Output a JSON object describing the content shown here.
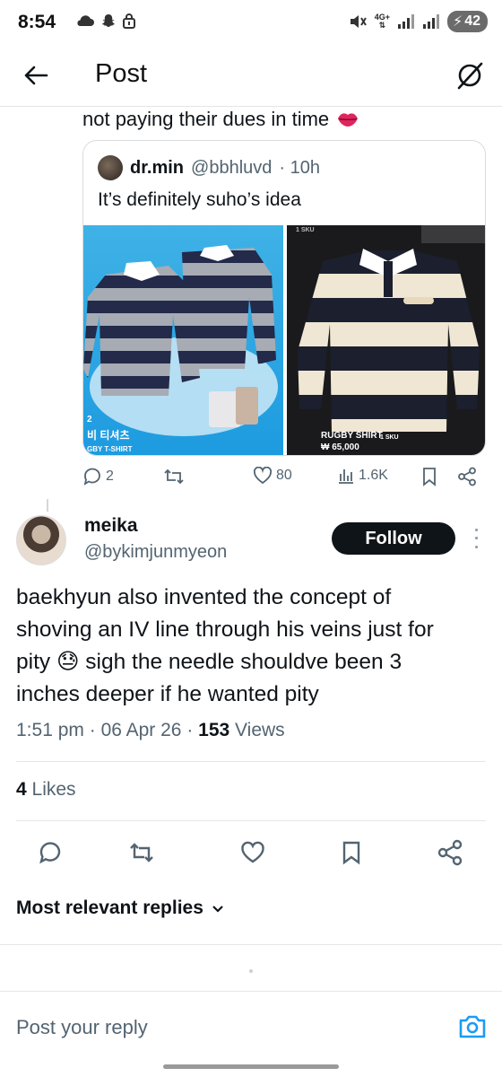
{
  "status_bar": {
    "time": "8:54",
    "network": "4G+",
    "battery": "42",
    "icons": [
      "cloud-icon",
      "snapchat-icon",
      "lock-icon",
      "mute-icon",
      "signal-icon",
      "signal-icon",
      "battery-icon"
    ]
  },
  "header": {
    "title": "Post",
    "back_icon": "arrow-left-icon",
    "grok_icon": "grok-icon"
  },
  "quoted_context": {
    "tail_text": "not paying their dues in time",
    "emoji": "lips-emoji"
  },
  "quote_tweet": {
    "name": "dr.min",
    "handle": "@bbhluvd",
    "time": "· 10h",
    "text": "It’s definitely suho’s idea",
    "media_left_caption_kr": "비 티셔츠",
    "media_left_caption_en": "GBY T-SHIRT",
    "media_left_number": "2",
    "media_right_caption": "RUGBY SHIRT",
    "media_right_sku": "1 SKU",
    "media_right_price": "₩ 65,000",
    "media_right_top_label": "1 SKU"
  },
  "quote_metrics": {
    "replies": "2",
    "likes": "80",
    "views": "1.6K"
  },
  "post": {
    "name": "meika",
    "handle": "@bykimjunmyeon",
    "follow_label": "Follow",
    "text_part1": "baekhyun also invented the concept of shoving an IV line through his veins just for pity ",
    "emoji": "😓",
    "text_part2": " sigh the needle shouldve been 3 inches deeper if he wanted pity",
    "time": "1:51 pm",
    "date": "06 Apr 26",
    "views_count": "153",
    "views_label": "Views",
    "likes_count": "4",
    "likes_label": "Likes"
  },
  "replies_section": {
    "sort_label": "Most relevant replies"
  },
  "reply_bar": {
    "placeholder": "Post your reply"
  },
  "colors": {
    "text": "#0f1419",
    "secondary": "#536471",
    "accent": "#1d9bf0",
    "divider": "#e6e6e6"
  }
}
